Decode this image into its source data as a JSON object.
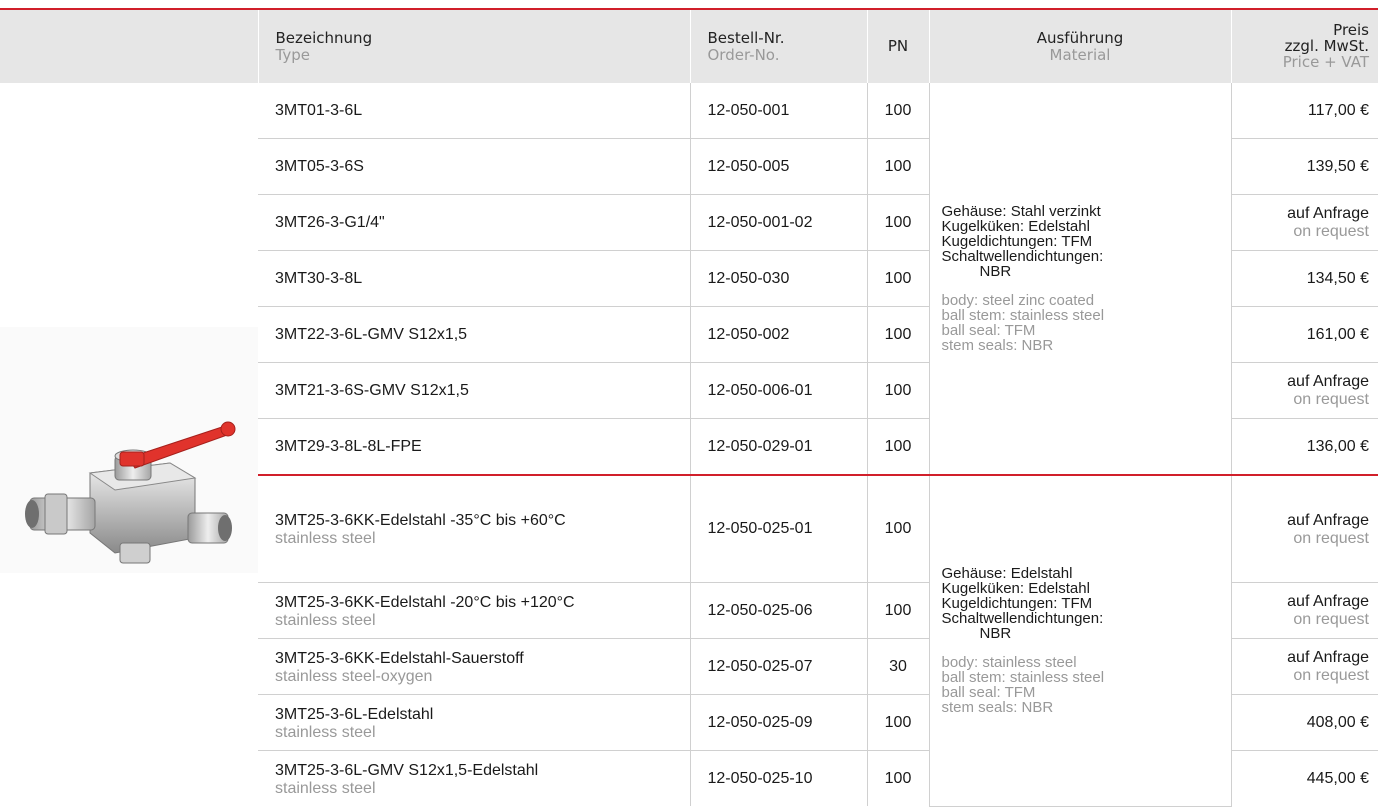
{
  "header": {
    "type_de": "Bezeichnung",
    "type_en": "Type",
    "order_de": "Bestell-Nr.",
    "order_en": "Order-No.",
    "pn": "PN",
    "material_de": "Ausführung",
    "material_en": "Material",
    "price_de_1": "Preis",
    "price_de_2": "zzgl. MwSt.",
    "price_en": "Price + VAT"
  },
  "group1": {
    "material_de": [
      "Gehäuse: Stahl verzinkt",
      "Kugelküken: Edelstahl",
      "Kugeldichtungen: TFM",
      "Schaltwellendichtungen:",
      "NBR"
    ],
    "material_en": [
      "body: steel zinc coated",
      "ball stem: stainless steel",
      "ball seal: TFM",
      "stem seals: NBR"
    ],
    "rows": [
      {
        "type": "3MT01-3-6L",
        "order": "12-050-001",
        "pn": "100",
        "price": "117,00 €",
        "price_sub": ""
      },
      {
        "type": "3MT05-3-6S",
        "order": "12-050-005",
        "pn": "100",
        "price": "139,50 €",
        "price_sub": ""
      },
      {
        "type": "3MT26-3-G1/4\"",
        "order": "12-050-001-02",
        "pn": "100",
        "price": "auf Anfrage",
        "price_sub": "on request"
      },
      {
        "type": "3MT30-3-8L",
        "order": "12-050-030",
        "pn": "100",
        "price": "134,50 €",
        "price_sub": ""
      },
      {
        "type": "3MT22-3-6L-GMV S12x1,5",
        "order": "12-050-002",
        "pn": "100",
        "price": "161,00 €",
        "price_sub": ""
      },
      {
        "type": "3MT21-3-6S-GMV S12x1,5",
        "order": "12-050-006-01",
        "pn": "100",
        "price": "auf Anfrage",
        "price_sub": "on request"
      },
      {
        "type": "3MT29-3-8L-8L-FPE",
        "order": "12-050-029-01",
        "pn": "100",
        "price": "136,00 €",
        "price_sub": ""
      }
    ]
  },
  "group2": {
    "material_de": [
      "Gehäuse: Edelstahl",
      "Kugelküken: Edelstahl",
      "Kugeldichtungen: TFM",
      "Schaltwellendichtungen:",
      "NBR"
    ],
    "material_en": [
      "body: stainless steel",
      "ball stem: stainless steel",
      "ball seal: TFM",
      "stem seals: NBR"
    ],
    "rows": [
      {
        "type": "3MT25-3-6KK-Edelstahl -35°C bis +60°C",
        "type_sub": "stainless steel",
        "order": "12-050-025-01",
        "pn": "100",
        "price": "auf Anfrage",
        "price_sub": "on request"
      },
      {
        "type": "3MT25-3-6KK-Edelstahl -20°C bis +120°C",
        "type_sub": "stainless steel",
        "order": "12-050-025-06",
        "pn": "100",
        "price": "auf Anfrage",
        "price_sub": "on request"
      },
      {
        "type": "3MT25-3-6KK-Edelstahl-Sauerstoff",
        "type_sub": "stainless steel-oxygen",
        "order": "12-050-025-07",
        "pn": "30",
        "price": "auf Anfrage",
        "price_sub": "on request"
      },
      {
        "type": "3MT25-3-6L-Edelstahl",
        "type_sub": "stainless steel",
        "order": "12-050-025-09",
        "pn": "100",
        "price": "408,00 €",
        "price_sub": ""
      },
      {
        "type": "3MT25-3-6L-GMV S12x1,5-Edelstahl",
        "type_sub": "stainless steel",
        "order": "12-050-025-10",
        "pn": "100",
        "price": "445,00 €",
        "price_sub": ""
      }
    ]
  },
  "colors": {
    "accent": "#d11f2a",
    "header_bg": "#e6e6e6",
    "muted": "#999999"
  },
  "icons": {
    "product": "three-way-ball-valve-icon"
  }
}
